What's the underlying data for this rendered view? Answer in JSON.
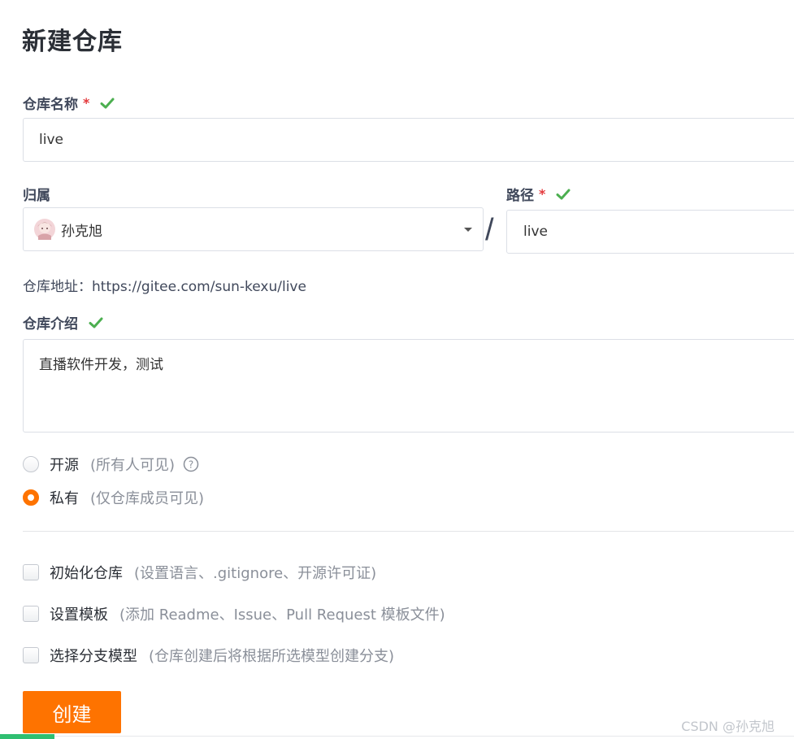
{
  "page": {
    "title": "新建仓库"
  },
  "repo_name": {
    "label": "仓库名称",
    "required_mark": "*",
    "value": "live"
  },
  "owner": {
    "label": "归属",
    "value": "孙克旭"
  },
  "separator": "/",
  "path": {
    "label": "路径",
    "required_mark": "*",
    "value": "live"
  },
  "repo_address": {
    "label": "仓库地址：",
    "url": "https://gitee.com/sun-kexu/live"
  },
  "description": {
    "label": "仓库介绍",
    "value": "直播软件开发，测试"
  },
  "visibility": {
    "options": [
      {
        "label": "开源",
        "hint": "(所有人可见)",
        "selected": false
      },
      {
        "label": "私有",
        "hint": "(仅仓库成员可见)",
        "selected": true
      }
    ],
    "help_icon": "question-circle-icon"
  },
  "extras": [
    {
      "label": "初始化仓库",
      "hint": "(设置语言、.gitignore、开源许可证)",
      "checked": false
    },
    {
      "label": "设置模板",
      "hint": "(添加 Readme、Issue、Pull Request 模板文件)",
      "checked": false
    },
    {
      "label": "选择分支模型",
      "hint": "(仓库创建后将根据所选模型创建分支)",
      "checked": false
    }
  ],
  "create_button": {
    "label": "创建"
  },
  "watermark": "CSDN @孙克旭",
  "colors": {
    "accent": "#fe7300",
    "check": "#4caf50",
    "required": "#e4393c",
    "muted": "#8a8f99"
  }
}
